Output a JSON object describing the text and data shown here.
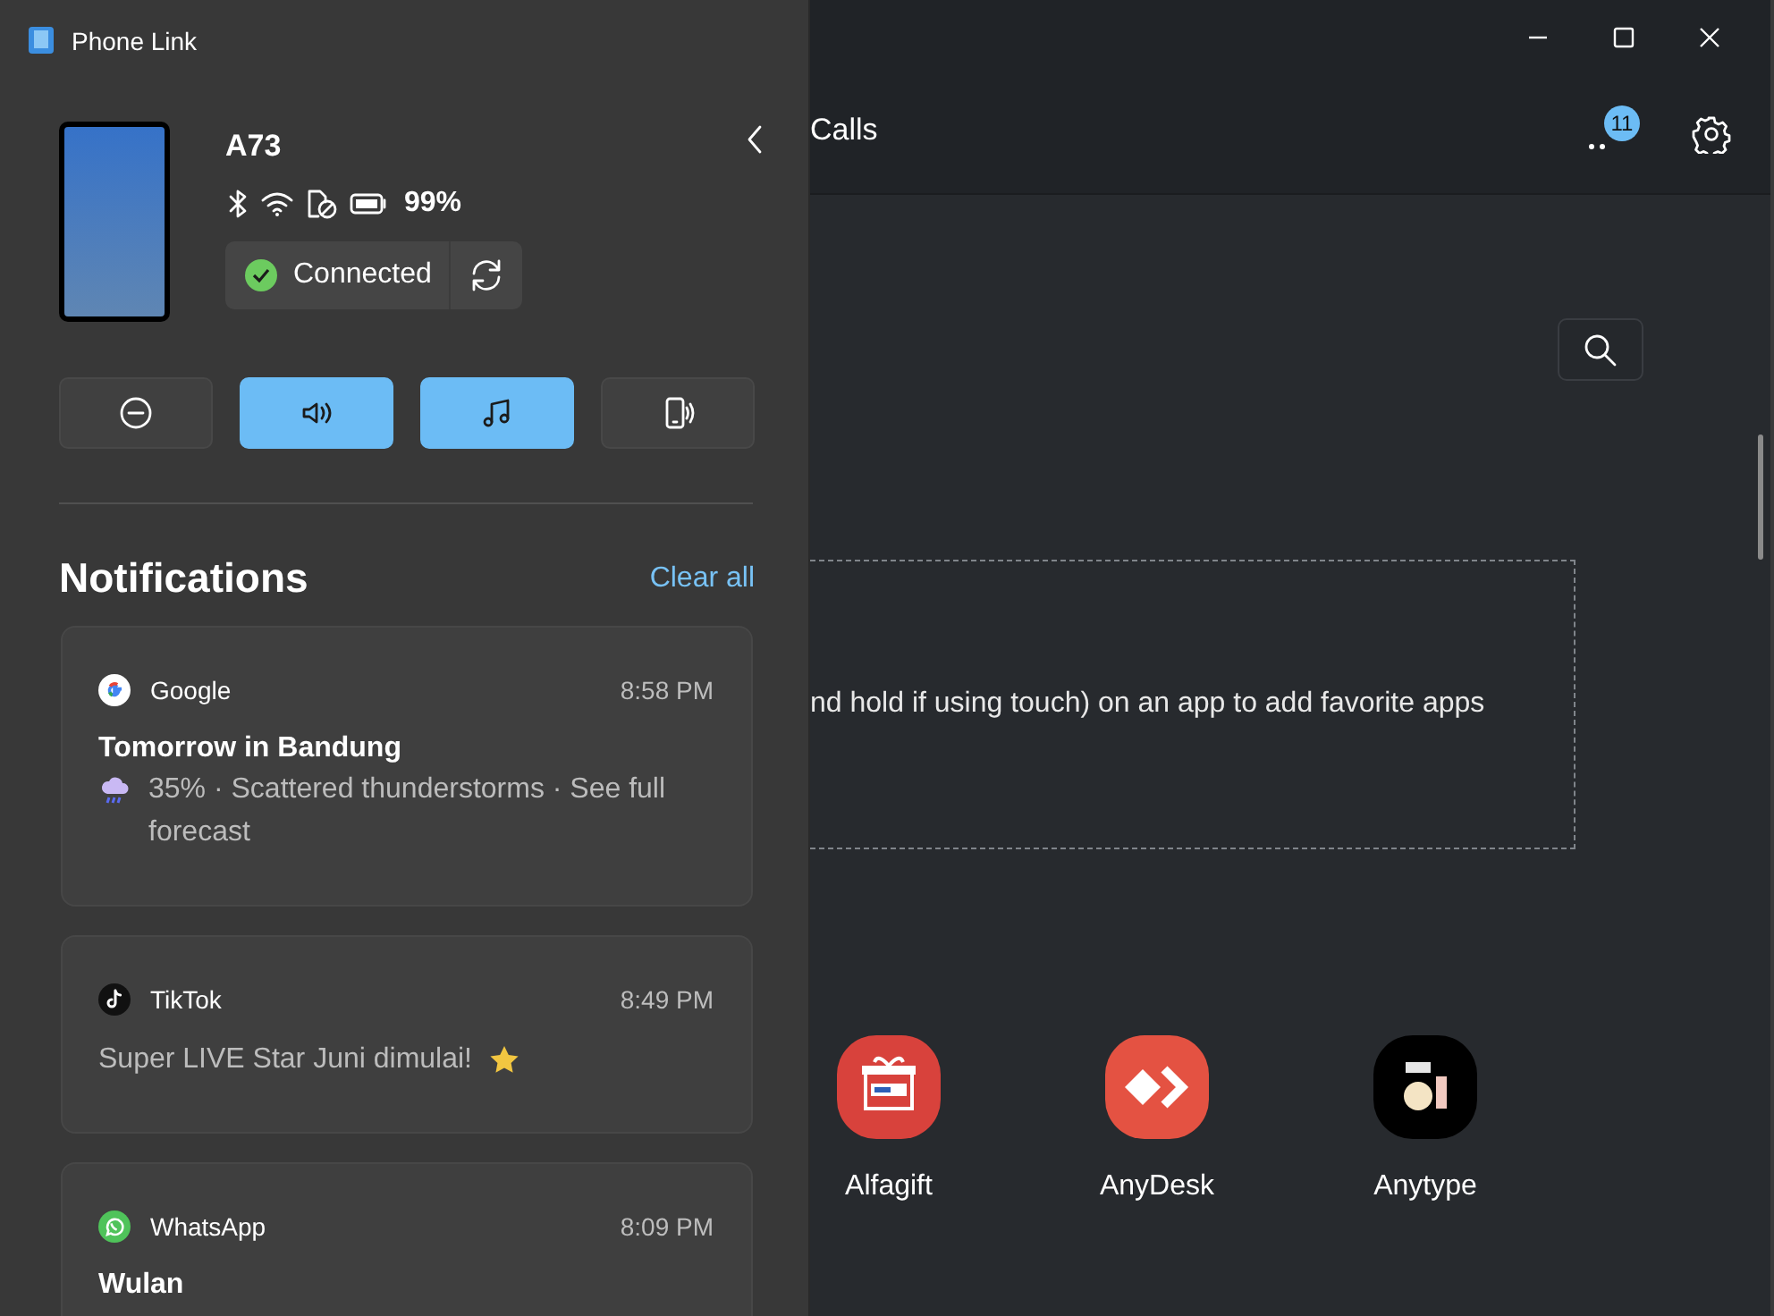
{
  "window": {
    "title": "Phone Link"
  },
  "device": {
    "name": "A73",
    "battery": "99%",
    "status": {
      "label": "Connected",
      "connected": true
    }
  },
  "quick_actions": [
    {
      "kind": "dnd",
      "on": false
    },
    {
      "kind": "volume",
      "on": true
    },
    {
      "kind": "music",
      "on": true
    },
    {
      "kind": "ringer",
      "on": false
    }
  ],
  "notifications": {
    "heading": "Notifications",
    "clear_all": "Clear all",
    "items": [
      {
        "kind": "google",
        "app": "Google",
        "time": "8:58 PM",
        "title": "Tomorrow in Bandung",
        "body": "35% · Scattered thunderstorms · See full forecast",
        "leading_icon": {
          "kind": "weather"
        }
      },
      {
        "kind": "tiktok",
        "app": "TikTok",
        "time": "8:49 PM",
        "body": "Super LIVE Star Juni dimulai!",
        "trailing_icon": {
          "kind": "star"
        }
      },
      {
        "kind": "whatsapp",
        "app": "WhatsApp",
        "time": "8:09 PM",
        "title": "Wulan"
      }
    ]
  },
  "main": {
    "tab": "Calls",
    "badge": "11",
    "favorites_hint": "nd hold if using touch) on an app to add favorite apps",
    "apps": [
      {
        "kind": "alfagift",
        "name": "Alfagift"
      },
      {
        "kind": "anydesk",
        "name": "AnyDesk"
      },
      {
        "kind": "anytype",
        "name": "Anytype"
      }
    ]
  }
}
